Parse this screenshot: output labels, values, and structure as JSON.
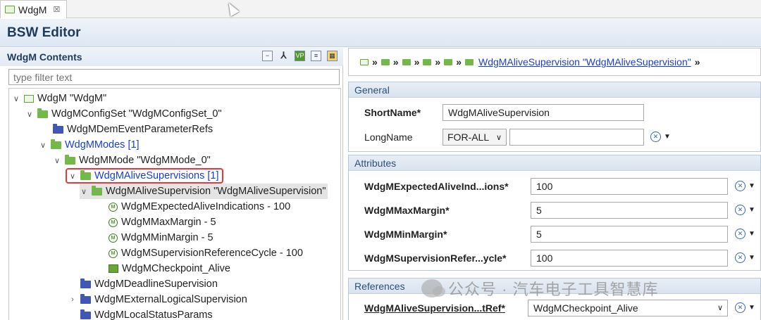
{
  "tab": {
    "label": "WdgM",
    "close": "☒"
  },
  "editor": {
    "title": "BSW Editor"
  },
  "left": {
    "title": "WdgM Contents",
    "filter_placeholder": "type filter text",
    "tree": [
      {
        "chev": "∨",
        "icon": "module",
        "label": "WdgM \"WdgM\"",
        "color": "normal"
      },
      {
        "chev": "∨",
        "icon": "folder",
        "label": "WdgMConfigSet \"WdgMConfigSet_0\"",
        "color": "normal"
      },
      {
        "chev": "",
        "icon": "folder-blue",
        "label": "WdgMDemEventParameterRefs",
        "color": "normal"
      },
      {
        "chev": "∨",
        "icon": "folder",
        "label": "WdgMModes [1]",
        "color": "link"
      },
      {
        "chev": "∨",
        "icon": "folder",
        "label": "WdgMMode \"WdgMMode_0\"",
        "color": "normal"
      },
      {
        "chev": "∨",
        "icon": "folder",
        "label": "WdgMAliveSupervisions [1]",
        "color": "link"
      },
      {
        "chev": "∨",
        "icon": "folder",
        "label": "WdgMAliveSupervision \"WdgMAliveSupervision\"",
        "color": "normal"
      },
      {
        "chev": "",
        "icon": "param",
        "label": "WdgMExpectedAliveIndications - 100",
        "color": "normal"
      },
      {
        "chev": "",
        "icon": "param",
        "label": "WdgMMaxMargin - 5",
        "color": "normal"
      },
      {
        "chev": "",
        "icon": "param",
        "label": "WdgMMinMargin - 5",
        "color": "normal"
      },
      {
        "chev": "",
        "icon": "param",
        "label": "WdgMSupervisionReferenceCycle - 100",
        "color": "normal"
      },
      {
        "chev": "",
        "icon": "ref",
        "label": "WdgMCheckpoint_Alive",
        "color": "normal"
      },
      {
        "chev": "",
        "icon": "folder-blue",
        "label": "WdgMDeadlineSupervision",
        "color": "normal"
      },
      {
        "chev": "›",
        "icon": "folder-blue",
        "label": "WdgMExternalLogicalSupervision",
        "color": "normal"
      },
      {
        "chev": "",
        "icon": "folder-blue",
        "label": "WdgMLocalStatusParams",
        "color": "normal"
      }
    ]
  },
  "right": {
    "breadcrumb_link": "WdgMAliveSupervision \"WdgMAliveSupervision\"",
    "breadcrumb_sep": "»",
    "general": {
      "title": "General",
      "shortname_label": "ShortName*",
      "shortname_value": "WdgMAliveSupervision",
      "longname_label": "LongName",
      "longname_lang": "FOR-ALL",
      "longname_value": ""
    },
    "attributes": {
      "title": "Attributes",
      "rows": [
        {
          "label": "WdgMExpectedAliveInd...ions*",
          "value": "100"
        },
        {
          "label": "WdgMMaxMargin*",
          "value": "5"
        },
        {
          "label": "WdgMMinMargin*",
          "value": "5"
        },
        {
          "label": "WdgMSupervisionRefer...ycle*",
          "value": "100"
        }
      ]
    },
    "references": {
      "title": "References",
      "label": "WdgMAliveSupervision...tRef*",
      "value": "WdgMCheckpoint_Alive"
    }
  },
  "watermark": "公众号 · 汽车电子工具智慧库",
  "colors": {
    "link": "#1a3fd0",
    "highlight": "#e23b3b",
    "folder": "#74b84a",
    "folder_blue": "#3f57b5"
  }
}
